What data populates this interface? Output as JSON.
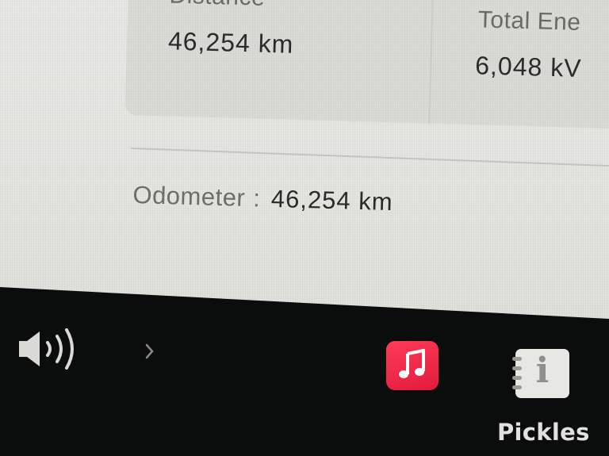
{
  "trip_stats": {
    "distance": {
      "label": "Distance",
      "value": "46,254 km"
    },
    "total_energy": {
      "label": "Total Ene",
      "value": "6,048 kV"
    }
  },
  "odometer": {
    "label": "Odometer",
    "separator": ":",
    "value": "46,254 km"
  },
  "taskbar": {
    "volume_icon": "speaker-volume-icon",
    "expand_icon": "chevron-right-icon",
    "apps": [
      {
        "name": "music-app",
        "icon": "music-note-icon",
        "color": "#fa2d48"
      },
      {
        "name": "owners-manual-app",
        "icon": "info-notebook-icon",
        "glyph": "i"
      }
    ]
  },
  "watermark": {
    "text": "Pickles"
  }
}
